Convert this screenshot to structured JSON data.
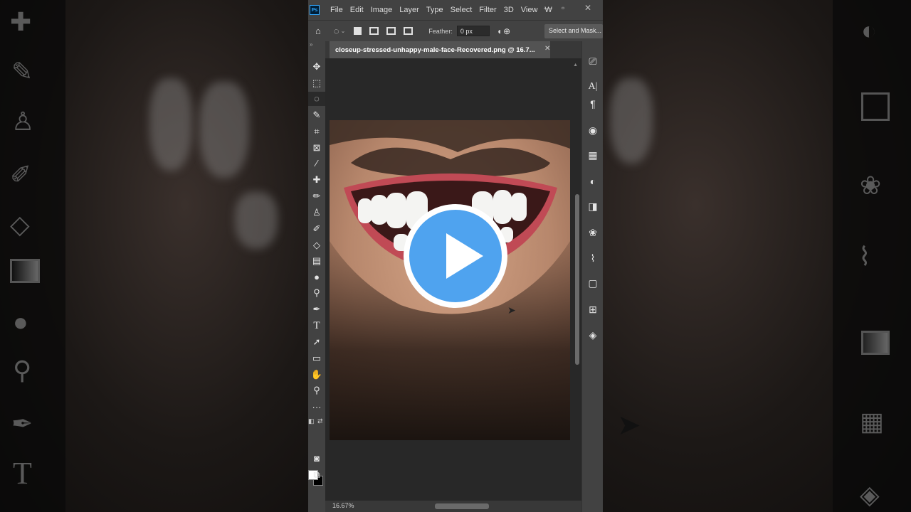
{
  "menu": {
    "logo": "Ps",
    "items": [
      "File",
      "Edit",
      "Image",
      "Layer",
      "Type",
      "Select",
      "Filter",
      "3D",
      "View",
      "W"
    ]
  },
  "options": {
    "feather_label": "Feather:",
    "feather_value": "0 px",
    "select_mask_label": "Select and Mask..."
  },
  "document": {
    "tab_title": "closeup-stressed-unhappy-male-face-Recovered.png @ 16.7...",
    "zoom": "16.67%"
  },
  "tools": [
    "move-tool",
    "marquee-tool",
    "lasso-tool",
    "quick-select-tool",
    "crop-tool",
    "frame-tool",
    "eyedropper-tool",
    "healing-brush-tool",
    "brush-tool",
    "clone-stamp-tool",
    "history-brush-tool",
    "eraser-tool",
    "gradient-tool",
    "blur-tool",
    "dodge-tool",
    "pen-tool",
    "type-tool",
    "path-select-tool",
    "shape-tool",
    "hand-tool",
    "zoom-tool",
    "more-tools"
  ],
  "colors": {
    "play_blue": "#4fa3ef",
    "foreground": "#ffffff",
    "background": "#000000"
  }
}
